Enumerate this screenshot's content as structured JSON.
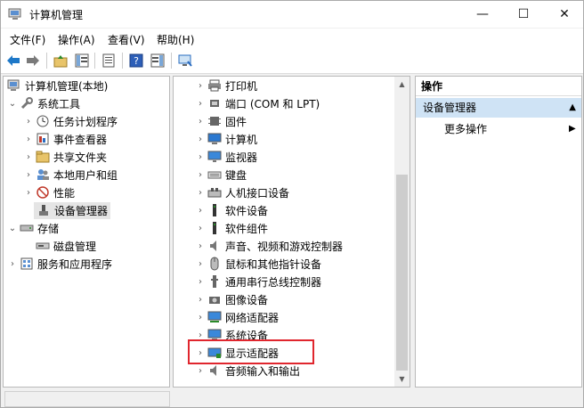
{
  "window": {
    "title": "计算机管理",
    "controls": {
      "minimize": "—",
      "maximize": "☐",
      "close": "✕"
    }
  },
  "menu": {
    "items": [
      "文件(F)",
      "操作(A)",
      "查看(V)",
      "帮助(H)"
    ]
  },
  "left_tree": {
    "root": "计算机管理(本地)",
    "system_tools": "系统工具",
    "children": [
      "任务计划程序",
      "事件查看器",
      "共享文件夹",
      "本地用户和组",
      "性能",
      "设备管理器"
    ],
    "storage": "存储",
    "storage_children": [
      "磁盘管理"
    ],
    "services": "服务和应用程序"
  },
  "device_list": {
    "items": [
      "打印机",
      "端口 (COM 和 LPT)",
      "固件",
      "计算机",
      "监视器",
      "键盘",
      "人机接口设备",
      "软件设备",
      "软件组件",
      "声音、视频和游戏控制器",
      "鼠标和其他指针设备",
      "通用串行总线控制器",
      "图像设备",
      "网络适配器",
      "系统设备",
      "显示适配器",
      "音频输入和输出"
    ]
  },
  "actions": {
    "header": "操作",
    "section": "设备管理器",
    "more": "更多操作"
  },
  "colors": {
    "highlight_box": "#e0262e",
    "actions_section_bg": "#cfe3f5"
  }
}
